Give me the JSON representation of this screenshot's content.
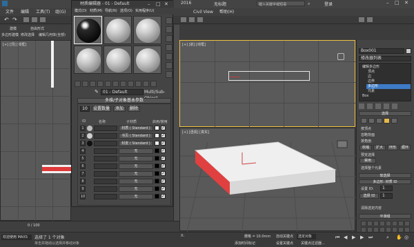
{
  "app": {
    "version_fragment": "2016",
    "title_fragment": "无标题",
    "search_placeholder": "键入关键字或短语",
    "login_label": "登录"
  },
  "menus": {
    "top_left": [
      "文件",
      "编辑",
      "工具(T)",
      "组(G)"
    ],
    "top_right": [
      "Civil View",
      "帮助(H)"
    ]
  },
  "left_panel": {
    "tabs": [
      "建模",
      "自由形式",
      "选择",
      "对象绘制",
      "填充"
    ],
    "sub": [
      "多边形建模",
      "修改选择",
      "编辑",
      "几何体(全部)"
    ],
    "viewport_label": "[+] [顶] [线框]",
    "ruler_frame": "0 / 100"
  },
  "material_editor": {
    "title": "材质编辑器 - 01 - Default",
    "menu": [
      "模式(D)",
      "材质(M)",
      "导航(N)",
      "选项(O)",
      "实用程序(U)"
    ],
    "material_name": "01 - Default",
    "material_type": "Multi/Sub-Object",
    "rollout_title": "多维/子对象基本参数",
    "count": "10",
    "set_count_label": "设置数量",
    "add_label": "添加",
    "delete_label": "删除",
    "col_id": "ID",
    "col_name": "名称",
    "col_submtl": "子材质",
    "col_onoff": "启用/禁用",
    "rows": [
      {
        "id": "1",
        "sub": "材质 ( Standard )",
        "swatch": "#f0f0f0"
      },
      {
        "id": "2",
        "sub": "书页 ( Standard )",
        "swatch": "#f0f0f0"
      },
      {
        "id": "3",
        "sub": "封皮 ( Standard )",
        "swatch": "#f0f0f0"
      },
      {
        "id": "4",
        "sub": "无",
        "swatch": "#000000"
      },
      {
        "id": "5",
        "sub": "无",
        "swatch": "#000000"
      },
      {
        "id": "6",
        "sub": "无",
        "swatch": "#000000"
      },
      {
        "id": "7",
        "sub": "无",
        "swatch": "#000000"
      },
      {
        "id": "8",
        "sub": "无",
        "swatch": "#000000"
      },
      {
        "id": "9",
        "sub": "无",
        "swatch": "#000000"
      },
      {
        "id": "10",
        "sub": "无",
        "swatch": "#000000"
      }
    ]
  },
  "viewports": {
    "top": "[+] [顶] [线框]",
    "front": "[+] [前] [线框]",
    "persp": "[+] [透视] [真实]"
  },
  "command_panel": {
    "object_name": "Box001",
    "modifier_list": "修改器列表",
    "stack": [
      "编辑多边形",
      "顶点",
      "边",
      "边界",
      "多边形",
      "元素",
      "Box"
    ],
    "selected_stack_index": 4,
    "rollout_selection": "选择",
    "sub_labels": [
      "按顶点",
      "忽略背面",
      "按角度:",
      "收缩",
      "扩大",
      "环形",
      "循环"
    ],
    "preview_label": "预览选择",
    "preview_off": "禁用",
    "selected_info": "选择整个元素",
    "soft_sel": "软选择",
    "edit_geo": "编辑几何体",
    "smoothing": "平滑组",
    "polymat": "多边形: 材质 ID",
    "set_id": "设置 ID:",
    "select_id": "选择 ID",
    "clear_select": "清除选定内容",
    "id_value": "1",
    "id_value2": "1"
  },
  "status": {
    "selected": "选择了 1 个对象",
    "script_label": "欢迎使用 MAXS",
    "hint": "单击并拖动以选择并移动对象",
    "x_label": "X:",
    "grid": "栅格 = 10.0mm",
    "add_time_tag": "添加时间标记",
    "auto_key": "自动关键点",
    "set_key": "设置关键点",
    "selected_obj": "选定对象",
    "key_filters": "关键点过滤器..."
  }
}
